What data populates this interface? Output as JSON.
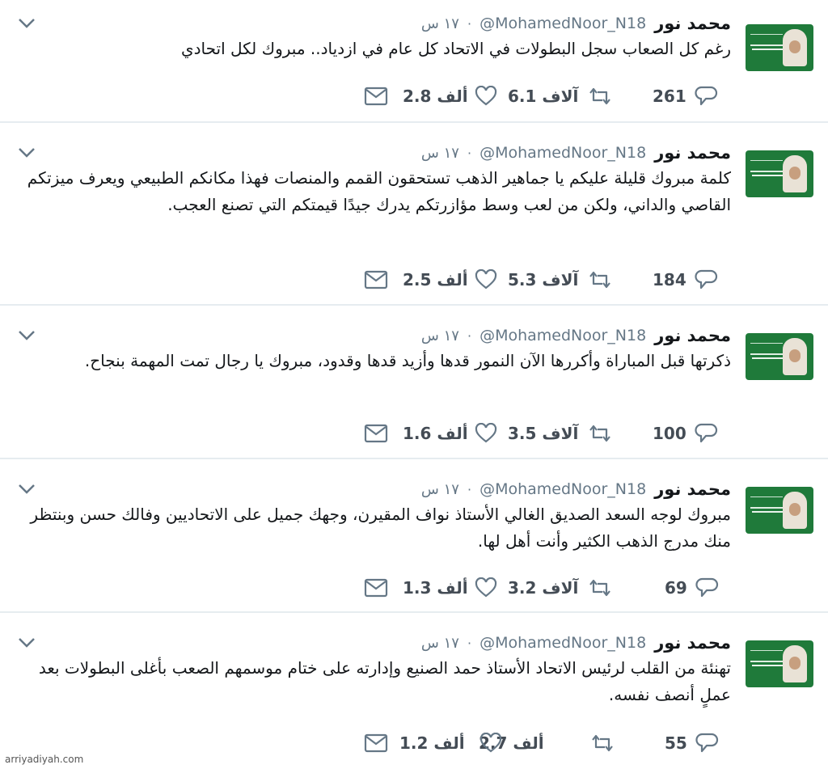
{
  "account": {
    "name": "محمد نور",
    "handle": "@MohamedNoor_N18",
    "dot": "·",
    "time": "١٧ س"
  },
  "icons": {
    "menu": "chevron-down-icon",
    "reply": "reply-icon",
    "retweet": "retweet-icon",
    "like": "heart-icon",
    "dm": "envelope-icon"
  },
  "colors": {
    "icon": "#657786",
    "separator": "#e6ecf0",
    "avatar_bg": "#1f7a3a"
  },
  "tweets": [
    {
      "text": "رغم كل الصعاب سجل البطولات في الاتحاد كل عام في ازدياد.. مبروك لكل اتحادي",
      "replies": "261",
      "retweets": "6.1 آلاف",
      "likes": "2.8 ألف"
    },
    {
      "text": "كلمة مبروك قليلة عليكم يا جماهير الذهب تستحقون القمم والمنصات فهذا مكانكم الطبيعي ويعرف ميزتكم القاصي والداني، ولكن من لعب وسط مؤازرتكم يدرك جيدًا قيمتكم التي تصنع العجب.",
      "replies": "184",
      "retweets": "5.3 آلاف",
      "likes": "2.5 ألف"
    },
    {
      "text": "ذكرتها قبل المباراة وأكررها الآن النمور قدها وأزيد قدها وقدود، مبروك يا رجال تمت المهمة بنجاح.",
      "replies": "100",
      "retweets": "3.5 آلاف",
      "likes": "1.6 ألف"
    },
    {
      "text": "مبروك لوجه السعد الصديق الغالي الأستاذ نواف المقيرن، وجهك جميل على الاتحاديين وفالك حسن وبنتظر منك مدرج الذهب الكثير وأنت أهل لها.",
      "replies": "69",
      "retweets": "3.2 آلاف",
      "likes": "1.3 ألف"
    },
    {
      "text": "تهنئة من القلب لرئيس الاتحاد الأستاذ حمد الصنيع وإدارته على ختام موسمهم الصعب بأغلى البطولات بعد عملٍ أنصف نفسه.",
      "replies": "55",
      "retweets": "2.7 ألف",
      "likes": "1.2 ألف"
    }
  ],
  "watermark": "arriyadiyah.com"
}
